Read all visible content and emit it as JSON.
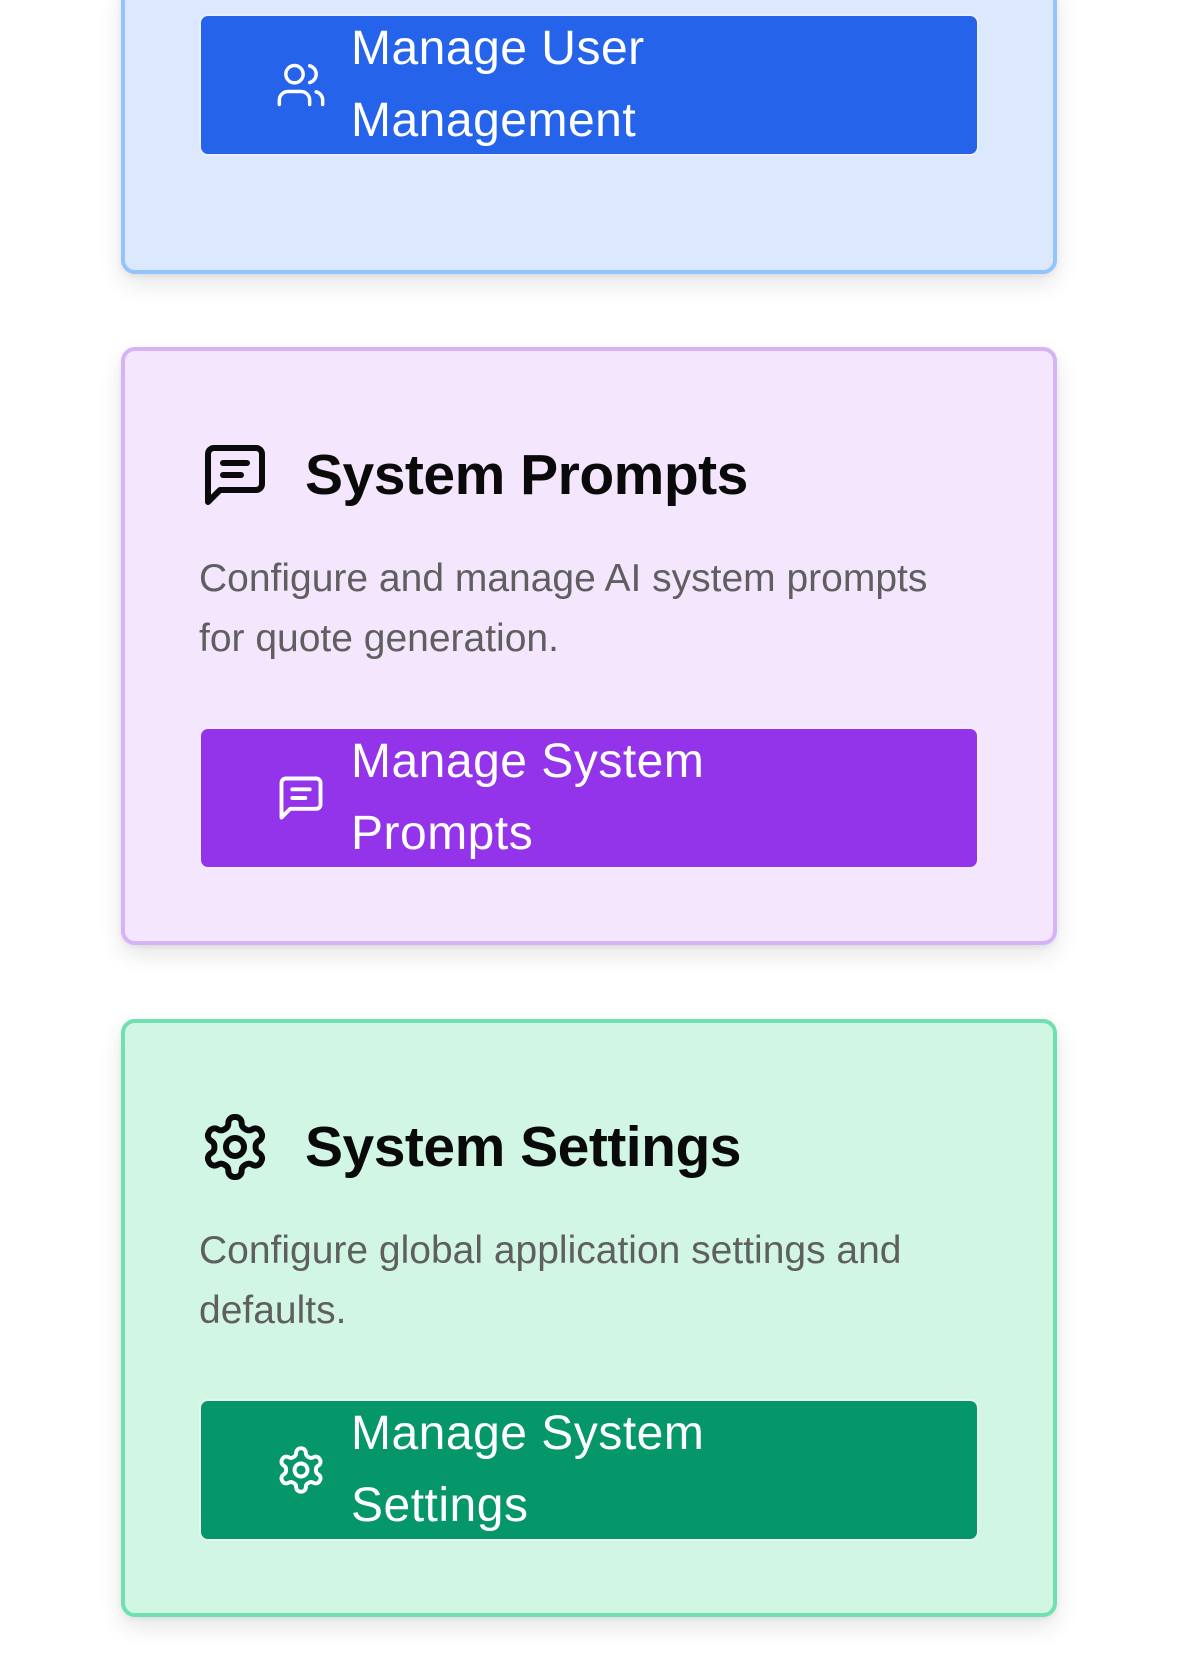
{
  "cards": [
    {
      "id": "user-management",
      "icon": "users-icon",
      "button_label": "Manage User Management",
      "accent": "#2563eb",
      "background": "#dbe8fd",
      "border": "#93c4fb"
    },
    {
      "id": "system-prompts",
      "icon": "message-square-text-icon",
      "title": "System Prompts",
      "description": "Configure and manage AI system prompts for quote generation.",
      "button_label": "Manage System Prompts",
      "accent": "#9333ea",
      "background": "#f3e6fd",
      "border": "#d6b3f9"
    },
    {
      "id": "system-settings",
      "icon": "gear-icon",
      "title": "System Settings",
      "description": "Configure global application settings and defaults.",
      "button_label": "Manage System Settings",
      "accent": "#059669",
      "background": "#d1f7e4",
      "border": "#6fe0b0"
    }
  ]
}
